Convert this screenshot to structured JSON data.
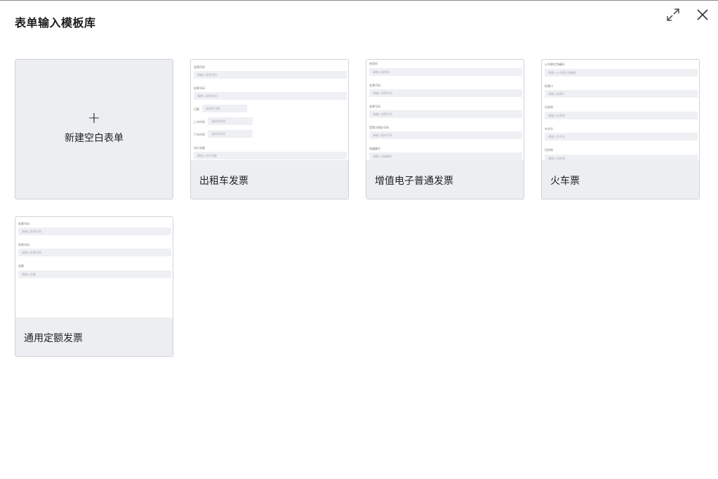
{
  "dialog": {
    "title": "表单输入模板库"
  },
  "blank_card": {
    "plus": "+",
    "label": "新建空白表单"
  },
  "templates": [
    {
      "label": "出租车发票",
      "fields": [
        {
          "label": "发票代码",
          "placeholder": "请输入发票代码"
        },
        {
          "label": "发票号码",
          "placeholder": "请输入发票号码"
        },
        {
          "label": "日期",
          "placeholder": "请选择日期"
        },
        {
          "label": "上车时间",
          "placeholder": "请选择时间"
        },
        {
          "label": "下车时间",
          "placeholder": "请选择时间"
        },
        {
          "label": "总价金额",
          "placeholder": "请输入总价金额"
        }
      ]
    },
    {
      "label": "增值电子普通发票",
      "fields": [
        {
          "label": "校验码",
          "placeholder": "请输入校验码"
        },
        {
          "label": "发票代码",
          "placeholder": "请输入发票代码"
        },
        {
          "label": "发票号码",
          "placeholder": "请输入发票号码"
        },
        {
          "label": "受票方税务号码",
          "placeholder": "请输入税务号码"
        },
        {
          "label": "机器编号",
          "placeholder": "请输入机器编号"
        }
      ]
    },
    {
      "label": "火车票",
      "fields": [
        {
          "label": "火车票红色编码",
          "placeholder": "请输入火车票红色编码"
        },
        {
          "label": "检票口",
          "placeholder": "请输入检票口"
        },
        {
          "label": "出发地",
          "placeholder": "请输入出发地"
        },
        {
          "label": "车次号",
          "placeholder": "请输入车次号"
        },
        {
          "label": "目的地",
          "placeholder": "请输入目的地"
        }
      ]
    },
    {
      "label": "通用定额发票",
      "fields": [
        {
          "label": "发票代码",
          "placeholder": "请输入发票代码"
        },
        {
          "label": "发票号码",
          "placeholder": "请输入发票号码"
        },
        {
          "label": "金额",
          "placeholder": "请输入金额"
        }
      ]
    }
  ],
  "icons": {
    "expand": "expand-icon",
    "close": "close-icon"
  }
}
